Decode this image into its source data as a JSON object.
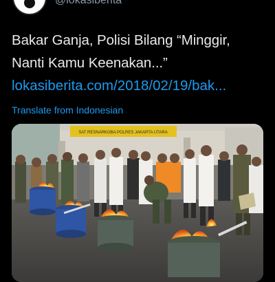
{
  "account": {
    "handle": "@lokasiberita"
  },
  "tweet": {
    "lines": [
      "Bakar Ganja, Polisi Bilang “Minggir,",
      "Nanti Kamu Keenakan...”"
    ],
    "link": "lokasiberita.com/2018/02/19/bak...",
    "translate_label": "Translate from Indonesian"
  },
  "media": {
    "sign_text": "SAT RESNARKOBA POLRES JAKARTA UTARA",
    "icon": "photo"
  },
  "colors": {
    "background": "#000000",
    "text": "#e7e9ea",
    "link": "#1d9bf0",
    "muted": "#8b98a5"
  }
}
